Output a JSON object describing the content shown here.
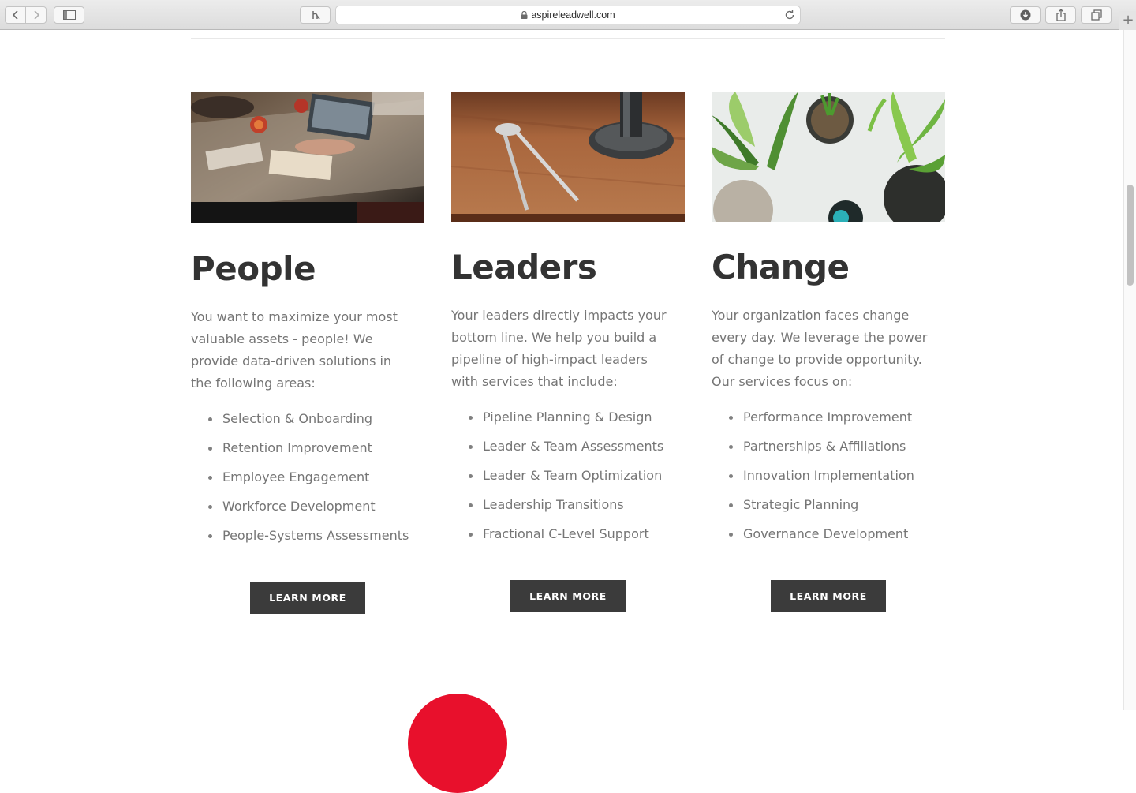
{
  "browser": {
    "url": "aspireleadwell.com"
  },
  "columns": [
    {
      "image_alt": "Team collaborating around a wooden table with laptops and drinks",
      "title": "People",
      "intro": "You want to maximize your most\nvaluable assets - people!  We\nprovide data-driven solutions in\nthe following areas:",
      "services": [
        "Selection & Onboarding",
        "Retention Improvement",
        "Employee Engagement",
        "Workforce Development",
        "People-Systems Assessments"
      ],
      "button": "LEARN MORE"
    },
    {
      "image_alt": "Drafting compass on a wooden desk beside a pipe flange",
      "title": "Leaders",
      "intro": "Your leaders directly impacts your\nbottom line.  We help you build a\npipeline of high-impact leaders\nwith services that include:",
      "services": [
        "Pipeline Planning & Design",
        "Leader & Team Assessments",
        "Leader & Team Optimization",
        "Leadership Transitions",
        "Fractional C-Level Support"
      ],
      "button": "LEARN MORE"
    },
    {
      "image_alt": "Overhead view of potted green plants",
      "title": "Change",
      "intro": "Your organization faces change\nevery day.  We leverage the power\nof change to provide opportunity.\nOur services focus on:",
      "services": [
        "Performance Improvement",
        "Partnerships & Affiliations",
        "Innovation Implementation",
        "Strategic Planning",
        "Governance Development"
      ],
      "button": "LEARN MORE"
    }
  ],
  "colors": {
    "heading": "#333333",
    "body_text": "#757575",
    "button_bg": "#3b3b3b",
    "accent_red": "#e8102c"
  }
}
